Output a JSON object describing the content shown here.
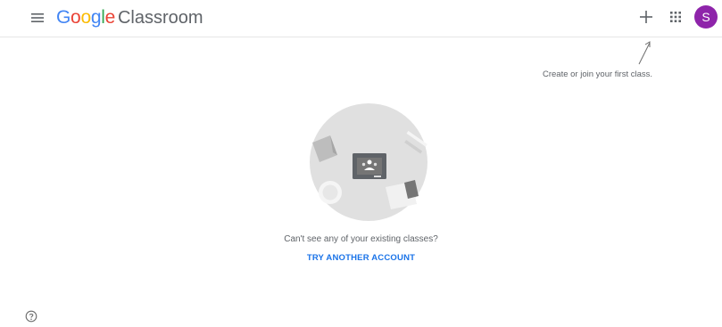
{
  "header": {
    "logo": {
      "letters": [
        "G",
        "o",
        "o",
        "g",
        "l",
        "e"
      ],
      "letter_colors": [
        "#4285f4",
        "#ea4335",
        "#fbbc05",
        "#4285f4",
        "#34a853",
        "#ea4335"
      ],
      "product": "Classroom"
    },
    "menu_icon": "hamburger-menu-icon",
    "add_icon": "plus-icon",
    "apps_icon": "apps-grid-icon",
    "avatar_initial": "S",
    "avatar_color": "#8e24aa"
  },
  "hint": {
    "text": "Create or join your first class."
  },
  "empty_state": {
    "message": "Can't see any of your existing classes?",
    "action_label": "TRY ANOTHER ACCOUNT",
    "action_color": "#1a73e8"
  },
  "footer": {
    "help_icon": "help-circle-icon"
  }
}
